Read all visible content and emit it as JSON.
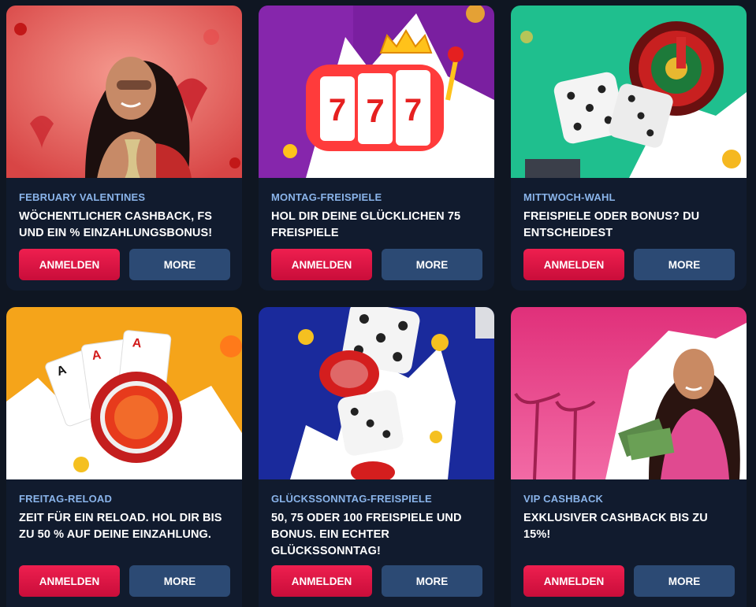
{
  "promotions": [
    {
      "subtitle": "FEBRUARY VALENTINES",
      "title": "WÖCHENTLICHER CASHBACK, FS UND EIN % EINZAHLUNGSBONUS!",
      "login_label": "ANMELDEN",
      "more_label": "MORE",
      "image_icon": "valentine-woman-illustration",
      "bg_color": "#e85a5a"
    },
    {
      "subtitle": "MONTAG-FREISPIELE",
      "title": "HOL DIR DEINE GLÜCKLICHEN 75 FREISPIELE",
      "login_label": "ANMELDEN",
      "more_label": "MORE",
      "image_icon": "slot-machine-777-icon",
      "bg_color": "#7a1fa0"
    },
    {
      "subtitle": "MITTWOCH-WAHL",
      "title": "FREISPIELE ODER BONUS? DU ENTSCHEIDEST",
      "login_label": "ANMELDEN",
      "more_label": "MORE",
      "image_icon": "dice-roulette-icon",
      "bg_color": "#1fbf8e"
    },
    {
      "subtitle": "FREITAG-RELOAD",
      "title": "ZEIT FÜR EIN RELOAD. HOL DIR BIS ZU 50 % AUF DEINE EINZAHLUNG.",
      "login_label": "ANMELDEN",
      "more_label": "MORE",
      "image_icon": "cards-chip-icon",
      "bg_color": "#f5a41a"
    },
    {
      "subtitle": "GLÜCKSSONNTAG-FREISPIELE",
      "title": "50, 75 ODER 100 FREISPIELE UND BONUS. EIN ECHTER GLÜCKSSONNTAG!",
      "login_label": "ANMELDEN",
      "more_label": "MORE",
      "image_icon": "dice-chips-icon",
      "bg_color": "#1a2a9c"
    },
    {
      "subtitle": "VIP CASHBACK",
      "title": "EXKLUSIVER CASHBACK BIS ZU 15%!",
      "login_label": "ANMELDEN",
      "more_label": "MORE",
      "image_icon": "vip-woman-money-illustration",
      "bg_color": "#e0307a"
    }
  ],
  "colors": {
    "page_bg": "#0f1622",
    "card_bg": "#111b2e",
    "subtitle": "#8ab4ea",
    "login_button": "#e3174a",
    "more_button": "#2c4a74"
  }
}
